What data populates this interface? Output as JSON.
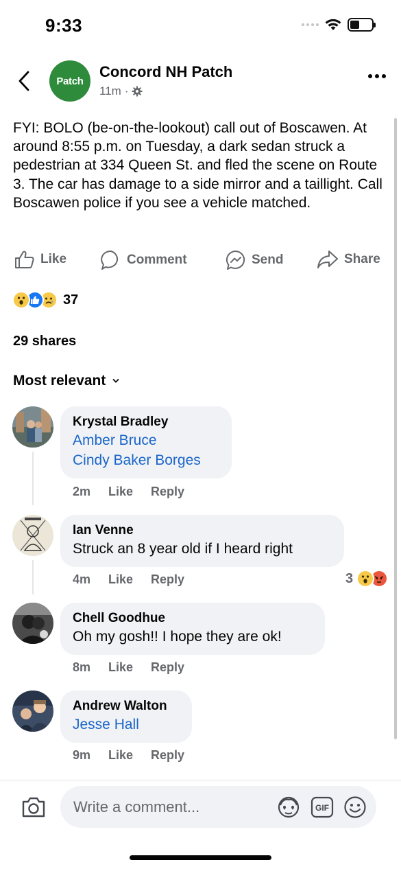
{
  "status_bar": {
    "time": "9:33",
    "battery_level_pct": 30,
    "icons": [
      "signal-icon",
      "wifi-icon",
      "battery-icon"
    ]
  },
  "header": {
    "page_avatar_text": "Patch",
    "page_name": "Concord NH Patch",
    "time_ago": "11m",
    "separator": "·",
    "audience_icon": "gear-icon"
  },
  "post": {
    "text": "FYI: BOLO (be-on-the-lookout) call out of Boscawen. At around 8:55 p.m. on Tuesday, a dark sedan struck a pedestrian at 334 Queen St. and fled the scene on Route 3. The car has damage to a side mirror and a taillight. Call Boscawen police if you see a vehicle matched."
  },
  "actions": {
    "like": "Like",
    "comment": "Comment",
    "send": "Send",
    "share": "Share"
  },
  "reactions": {
    "types": [
      "wow",
      "like",
      "sad"
    ],
    "count": "37"
  },
  "shares_text": "29 shares",
  "sort_label": "Most relevant",
  "comments": [
    {
      "author": "Krystal Bradley",
      "links": [
        "Amber Bruce",
        "Cindy Baker Borges"
      ],
      "time": "2m",
      "like": "Like",
      "reply": "Reply"
    },
    {
      "author": "Ian Venne",
      "text": "Struck an 8 year old if I heard right",
      "time": "4m",
      "like": "Like",
      "reply": "Reply",
      "reaction_count": "3",
      "reaction_types": [
        "wow",
        "angry"
      ]
    },
    {
      "author": "Chell Goodhue",
      "text": "Oh my gosh!! I hope they are ok!",
      "time": "8m",
      "like": "Like",
      "reply": "Reply"
    },
    {
      "author": "Andrew Walton",
      "links": [
        "Jesse Hall"
      ],
      "time": "9m",
      "like": "Like",
      "reply": "Reply"
    }
  ],
  "composer": {
    "placeholder": "Write a comment...",
    "icons": [
      "camera-icon",
      "avatar-sticker-icon",
      "gif-icon",
      "emoji-icon"
    ]
  },
  "colors": {
    "patch_green": "#2e8b3b",
    "link_blue": "#1b66c9",
    "secondary_text": "#65676b",
    "bubble_bg": "#f0f2f5",
    "like_blue": "#1877f2"
  }
}
